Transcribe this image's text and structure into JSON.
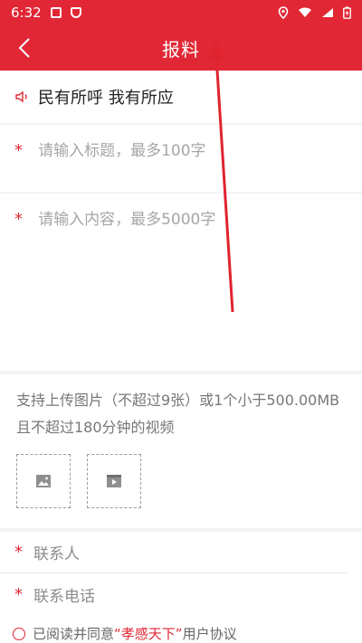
{
  "status_bar": {
    "time": "6:32"
  },
  "header": {
    "title": "报料"
  },
  "notice": {
    "text": "民有所呼  我有所应"
  },
  "form": {
    "title_placeholder": "请输入标题，最多100字",
    "content_placeholder": "请输入内容，最多5000字",
    "required_mark": "*"
  },
  "upload": {
    "description": "支持上传图片（不超过9张）或1个小于500.00MB且不超过180分钟的视频"
  },
  "contact": {
    "name_label": "联系人",
    "phone_label": "联系电话"
  },
  "agreement": {
    "prefix": "已阅读并同意",
    "link": "“孝感天下”",
    "suffix": "用户协议"
  },
  "colors": {
    "brand_red": "#e12735"
  }
}
